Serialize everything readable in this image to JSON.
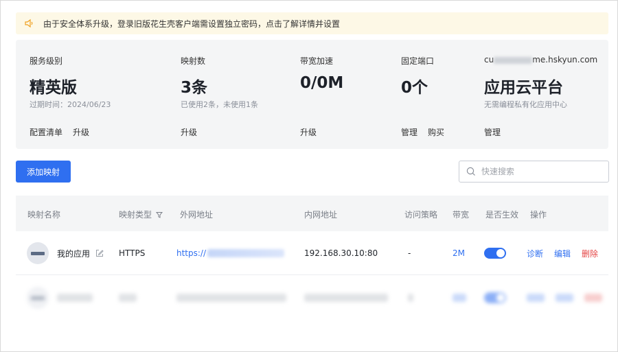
{
  "notice": {
    "icon": "speaker-icon",
    "text": "由于安全体系升级，登录旧版花生壳客户端需设置独立密码，点击了解详情并设置"
  },
  "stats": {
    "service": {
      "label": "服务级别",
      "value": "精英版",
      "sub": "过期时间：2024/06/23",
      "actions": [
        "配置清单",
        "升级"
      ]
    },
    "mappings": {
      "label": "映射数",
      "value": "3条",
      "sub": "已使用2条，未使用1条",
      "actions": [
        "升级"
      ]
    },
    "bandwidth": {
      "label": "带宽加速",
      "value": "0/0M",
      "sub": "",
      "actions": [
        "升级"
      ]
    },
    "ports": {
      "label": "固定端口",
      "value": "0个",
      "sub": "",
      "actions": [
        "管理",
        "购买"
      ]
    },
    "cloud": {
      "label_prefix": "cu",
      "label_suffix": "me.hskyun.com",
      "value": "应用云平台",
      "sub": "无需编程私有化应用中心",
      "actions": [
        "管理"
      ]
    }
  },
  "toolbar": {
    "add_label": "添加映射",
    "search_placeholder": "快速搜索"
  },
  "table": {
    "headers": [
      "映射名称",
      "映射类型",
      "外网地址",
      "内网地址",
      "访问策略",
      "带宽",
      "是否生效",
      "操作"
    ],
    "rows": [
      {
        "name": "我的应用",
        "type": "HTTPS",
        "external_prefix": "https://",
        "internal": "192.168.30.10:80",
        "policy": "-",
        "bandwidth": "2M",
        "enabled": true,
        "actions": {
          "diagnose": "诊断",
          "edit": "编辑",
          "delete": "删除"
        }
      }
    ]
  },
  "colors": {
    "accent": "#2f6ff0",
    "danger": "#e54545",
    "notice_bg": "#fdf8e6",
    "panel_bg": "#f4f5f6"
  }
}
